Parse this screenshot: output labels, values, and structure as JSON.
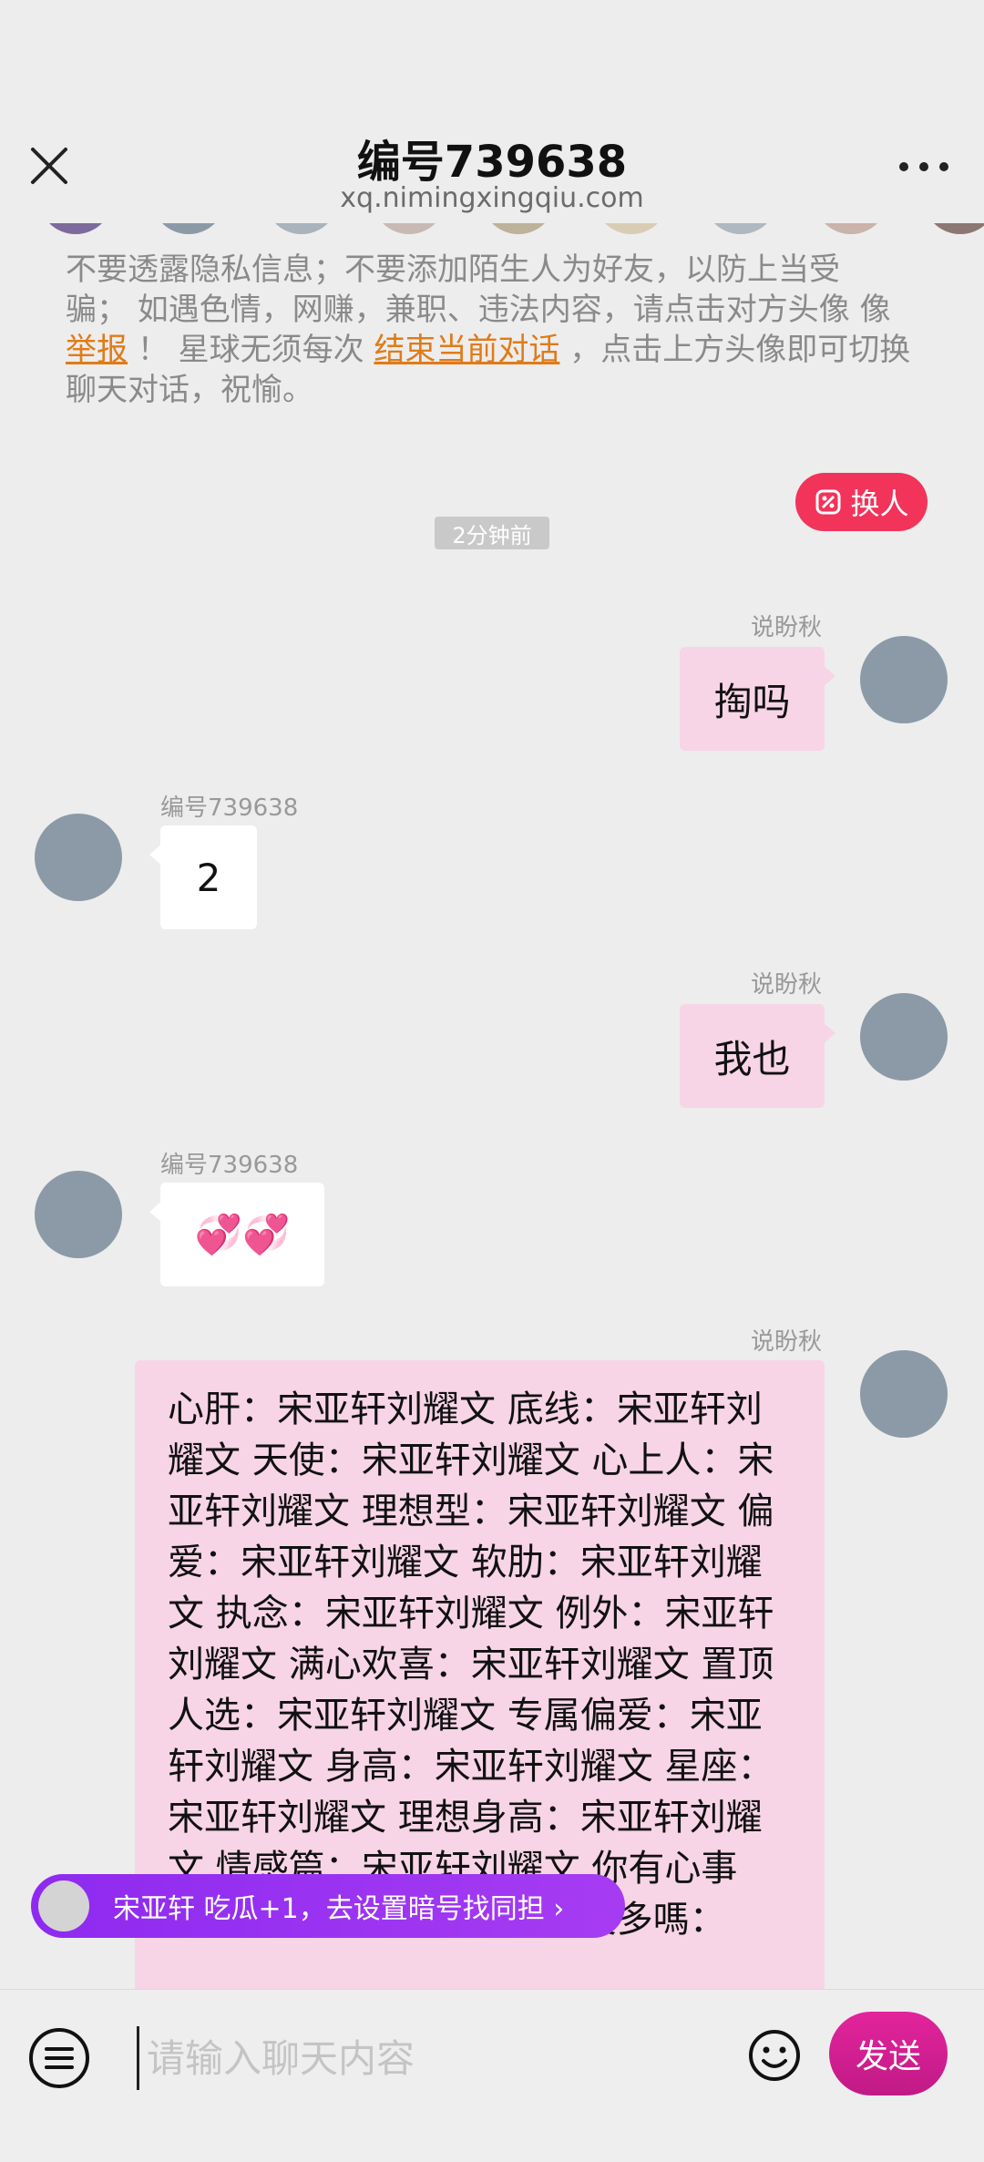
{
  "header": {
    "title": "编号739638",
    "subtitle": "xq.nimingxingqiu.com"
  },
  "notice": {
    "line_top": "不要透露隐私信息；不要添加陌生人为好友，以防上当受",
    "part1": "骗； 如遇色情，网赚，兼职、违法内容，请点击对方头像",
    "report_link": "举报",
    "part2": "！  星球无须每次",
    "end_link": "结束当前对话",
    "part3": "，点击上方头像即可切换聊天对话，祝愉。"
  },
  "swap_button": {
    "label": "换人"
  },
  "time_badge": "2分钟前",
  "messages": [
    {
      "sender": "说盼秋",
      "text": "掏吗"
    },
    {
      "sender": "编号739638",
      "text": "2"
    },
    {
      "sender": "说盼秋",
      "text": "我也"
    },
    {
      "sender": "编号739638",
      "text": "💞💞"
    },
    {
      "sender": "说盼秋",
      "text": "心肝：宋亚轩刘耀文 底线：宋亚轩刘耀文 天使：宋亚轩刘耀文 心上人：宋亚轩刘耀文 理想型：宋亚轩刘耀文 偏爱：宋亚轩刘耀文 软肋：宋亚轩刘耀文 执念：宋亚轩刘耀文 例外：宋亚轩刘耀文 满心欢喜：宋亚轩刘耀文 置顶人选：宋亚轩刘耀文 专属偏爱：宋亚轩刘耀文 身高：宋亚轩刘耀文 星座：宋亚轩刘耀文 理想身高：宋亚轩刘耀文 情感篇：宋亚轩刘耀文 你有心事嗎：宋亚轩刘耀文 你的朋友多嗎："
    }
  ],
  "promo": {
    "text": "宋亚轩 吃瓜+1，去设置暗号找同担 ›"
  },
  "composer": {
    "placeholder": "请输入聊天内容",
    "send_label": "发送"
  },
  "colors": {
    "accent": "#f2335a",
    "my_bubble": "#f7d5e6",
    "promo": "#8e2af0",
    "send": "#d01f92"
  }
}
